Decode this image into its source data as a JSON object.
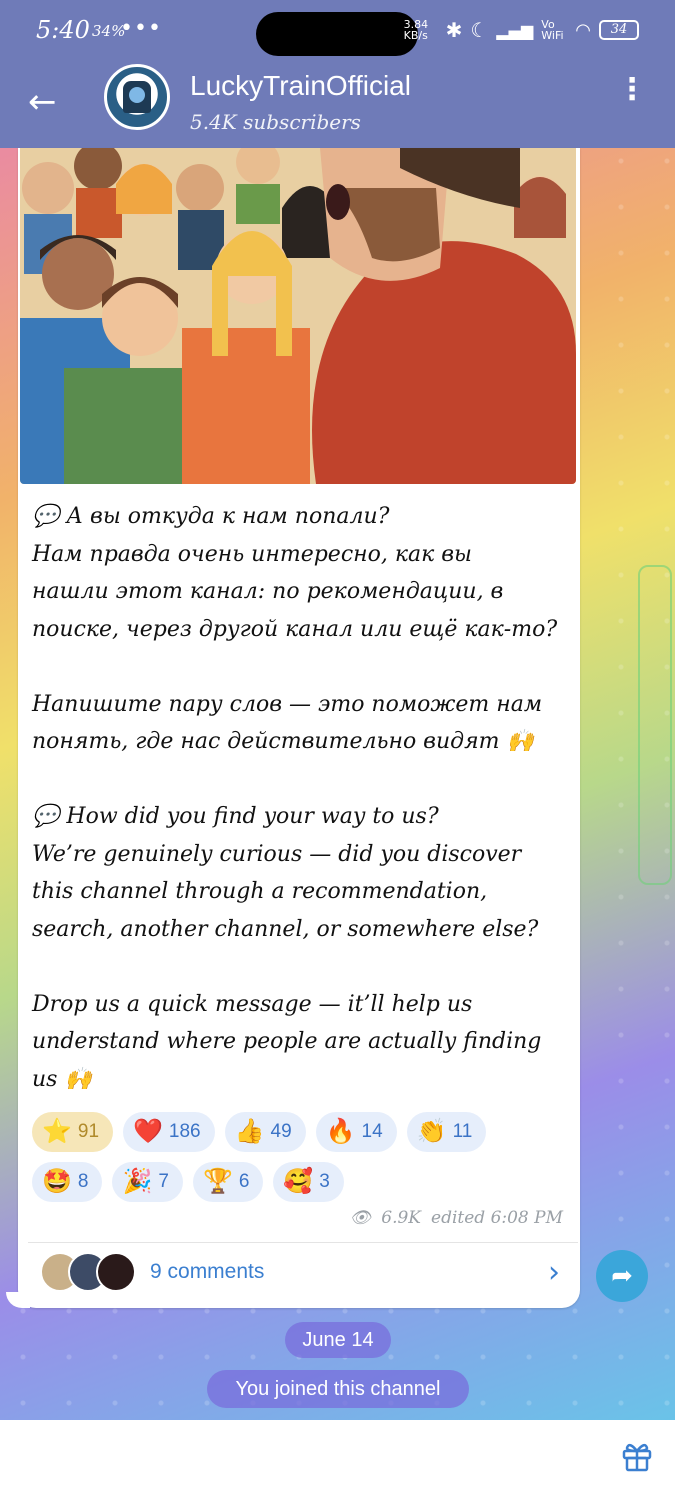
{
  "status_bar": {
    "time": "5:40",
    "battery_small": "34%",
    "more": "•••",
    "net_speed": "3.84 KB/s",
    "vowifi": "Vo WiFi",
    "battery": "34"
  },
  "header": {
    "channel_name": "LuckyTrainOfficial",
    "subscribers": "5.4K subscribers"
  },
  "post": {
    "lines": [
      "💬 А вы откуда к нам попали?",
      "Нам правда очень интересно, как вы",
      "нашли этот канал: по рекомендации, в",
      "поиске, через другой канал или ещё как-то?",
      "",
      "Напишите пару слов — это поможет нам",
      "понять, где нас действительно видят 🙌",
      "",
      "💬 How did you find your way to us?",
      "We’re genuinely curious — did you discover",
      "this channel through a recommendation,",
      "search, another channel, or somewhere else?",
      "",
      "Drop us a quick message — it’ll help us",
      "understand where people are actually finding",
      "us 🙌"
    ],
    "reactions": [
      {
        "emoji": "⭐",
        "count": "91",
        "active": true
      },
      {
        "emoji": "❤️",
        "count": "186"
      },
      {
        "emoji": "👍",
        "count": "49"
      },
      {
        "emoji": "🔥",
        "count": "14"
      },
      {
        "emoji": "👏",
        "count": "11"
      },
      {
        "emoji": "🤩",
        "count": "8"
      },
      {
        "emoji": "🎉",
        "count": "7"
      },
      {
        "emoji": "🏆",
        "count": "6"
      },
      {
        "emoji": "🥰",
        "count": "3"
      }
    ],
    "views": "6.9K",
    "edited": "edited 6:08 PM",
    "comments_label": "9 comments"
  },
  "chat": {
    "date": "June 14",
    "joined": "You joined this channel"
  },
  "colors": {
    "header_bg": "#6f7bb8",
    "link": "#3b7fd0",
    "share": "#3ba6da"
  }
}
